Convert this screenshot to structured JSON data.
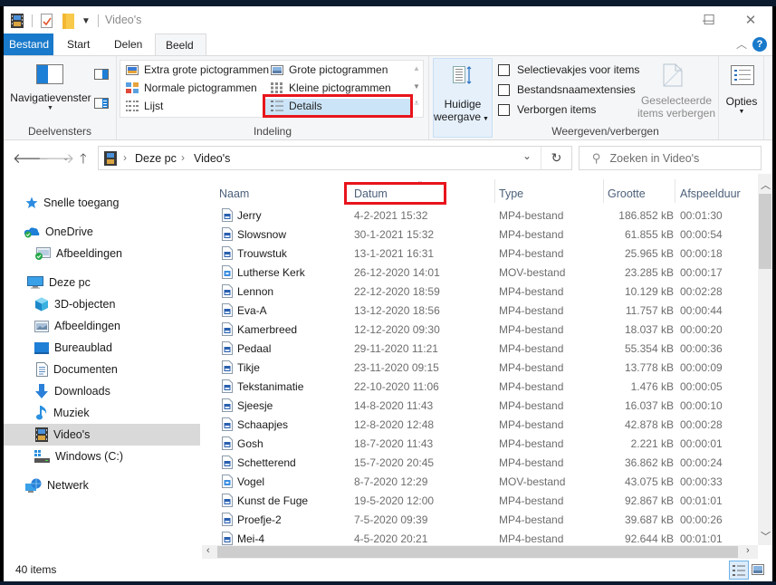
{
  "window": {
    "title": "Video's",
    "minimize_label": "—",
    "maximize_label": "☐",
    "close_label": "✕"
  },
  "ribbon_tabs": [
    {
      "label": "Bestand"
    },
    {
      "label": "Start"
    },
    {
      "label": "Delen"
    },
    {
      "label": "Beeld",
      "active": true
    }
  ],
  "ribbon": {
    "panes": {
      "nav_pane_label": "Navigatievenster",
      "group_label": "Deelvensters"
    },
    "layout": {
      "items": [
        "Extra grote pictogrammen",
        "Grote pictogrammen",
        "Normale pictogrammen",
        "Kleine pictogrammen",
        "Lijst",
        "Details"
      ],
      "selected": "Details",
      "group_label": "Indeling"
    },
    "current_view": {
      "line1": "Huidige",
      "line2": "weergave"
    },
    "show_hide": {
      "checkboxes": [
        {
          "label": "Selectievakjes voor items",
          "checked": false
        },
        {
          "label": "Bestandsnaamextensies",
          "checked": false
        },
        {
          "label": "Verborgen items",
          "checked": false
        }
      ],
      "hide_selected_line1": "Geselecteerde",
      "hide_selected_line2": "items verbergen",
      "group_label": "Weergeven/verbergen"
    },
    "options_label": "Opties"
  },
  "address_bar": {
    "breadcrumb": [
      "Deze pc",
      "Video's"
    ],
    "separator": "›",
    "search_placeholder": "Zoeken in Video's"
  },
  "sidebar": {
    "items": [
      {
        "label": "Snelle toegang",
        "icon": "star-icon",
        "level": 0
      },
      {
        "label": "OneDrive",
        "icon": "onedrive-icon",
        "level": 0
      },
      {
        "label": "Afbeeldingen",
        "icon": "pictures-synced-icon",
        "level": 1
      },
      {
        "label": "Deze pc",
        "icon": "computer-icon",
        "level": 0
      },
      {
        "label": "3D-objecten",
        "icon": "3d-objects-icon",
        "level": 1
      },
      {
        "label": "Afbeeldingen",
        "icon": "pictures-icon",
        "level": 1
      },
      {
        "label": "Bureaublad",
        "icon": "desktop-icon",
        "level": 1
      },
      {
        "label": "Documenten",
        "icon": "documents-icon",
        "level": 1
      },
      {
        "label": "Downloads",
        "icon": "downloads-icon",
        "level": 1
      },
      {
        "label": "Muziek",
        "icon": "music-icon",
        "level": 1
      },
      {
        "label": "Video's",
        "icon": "videos-icon",
        "level": 1,
        "selected": true
      },
      {
        "label": "Windows (C:)",
        "icon": "drive-icon",
        "level": 1
      },
      {
        "label": "Netwerk",
        "icon": "network-icon",
        "level": 0
      }
    ]
  },
  "file_list": {
    "columns": [
      "Naam",
      "Datum",
      "Type",
      "Grootte",
      "Afspeelduur"
    ],
    "sorted_by": "Datum",
    "rows": [
      {
        "name": "Jerry",
        "date": "4-2-2021 15:32",
        "type": "MP4-bestand",
        "size": "186.852 kB",
        "duration": "00:01:30"
      },
      {
        "name": "Slowsnow",
        "date": "30-1-2021 15:32",
        "type": "MP4-bestand",
        "size": "61.855 kB",
        "duration": "00:00:54"
      },
      {
        "name": "Trouwstuk",
        "date": "13-1-2021 16:31",
        "type": "MP4-bestand",
        "size": "25.965 kB",
        "duration": "00:00:18"
      },
      {
        "name": "Lutherse Kerk",
        "date": "26-12-2020 14:01",
        "type": "MOV-bestand",
        "size": "23.285 kB",
        "duration": "00:00:17"
      },
      {
        "name": "Lennon",
        "date": "22-12-2020 18:59",
        "type": "MP4-bestand",
        "size": "10.129 kB",
        "duration": "00:02:28"
      },
      {
        "name": "Eva-A",
        "date": "13-12-2020 18:56",
        "type": "MP4-bestand",
        "size": "11.757 kB",
        "duration": "00:00:44"
      },
      {
        "name": "Kamerbreed",
        "date": "12-12-2020 09:30",
        "type": "MP4-bestand",
        "size": "18.037 kB",
        "duration": "00:00:20"
      },
      {
        "name": "Pedaal",
        "date": "29-11-2020 11:21",
        "type": "MP4-bestand",
        "size": "55.354 kB",
        "duration": "00:00:36"
      },
      {
        "name": "Tikje",
        "date": "23-11-2020 09:15",
        "type": "MP4-bestand",
        "size": "13.778 kB",
        "duration": "00:00:09"
      },
      {
        "name": "Tekstanimatie",
        "date": "22-10-2020 11:06",
        "type": "MP4-bestand",
        "size": "1.476 kB",
        "duration": "00:00:05"
      },
      {
        "name": "Sjeesje",
        "date": "14-8-2020 11:43",
        "type": "MP4-bestand",
        "size": "16.037 kB",
        "duration": "00:00:10"
      },
      {
        "name": "Schaapjes",
        "date": "12-8-2020 12:48",
        "type": "MP4-bestand",
        "size": "42.878 kB",
        "duration": "00:00:28"
      },
      {
        "name": "Gosh",
        "date": "18-7-2020 11:43",
        "type": "MP4-bestand",
        "size": "2.221 kB",
        "duration": "00:00:01"
      },
      {
        "name": "Schetterend",
        "date": "15-7-2020 20:45",
        "type": "MP4-bestand",
        "size": "36.862 kB",
        "duration": "00:00:24"
      },
      {
        "name": "Vogel",
        "date": "8-7-2020 12:29",
        "type": "MOV-bestand",
        "size": "43.075 kB",
        "duration": "00:00:33"
      },
      {
        "name": "Kunst de Fuge",
        "date": "19-5-2020 12:00",
        "type": "MP4-bestand",
        "size": "92.867 kB",
        "duration": "00:01:01"
      },
      {
        "name": "Proefje-2",
        "date": "7-5-2020 09:39",
        "type": "MP4-bestand",
        "size": "39.687 kB",
        "duration": "00:00:26"
      },
      {
        "name": "Mei-4",
        "date": "4-5-2020 20:21",
        "type": "MP4-bestand",
        "size": "92.644 kB",
        "duration": "00:01:01"
      }
    ]
  },
  "status_bar": {
    "item_count": "40 items"
  },
  "colors": {
    "accent": "#1979ca",
    "highlight_box": "#e8141c",
    "selection": "#cce4f7",
    "header_text": "#4c607a"
  }
}
